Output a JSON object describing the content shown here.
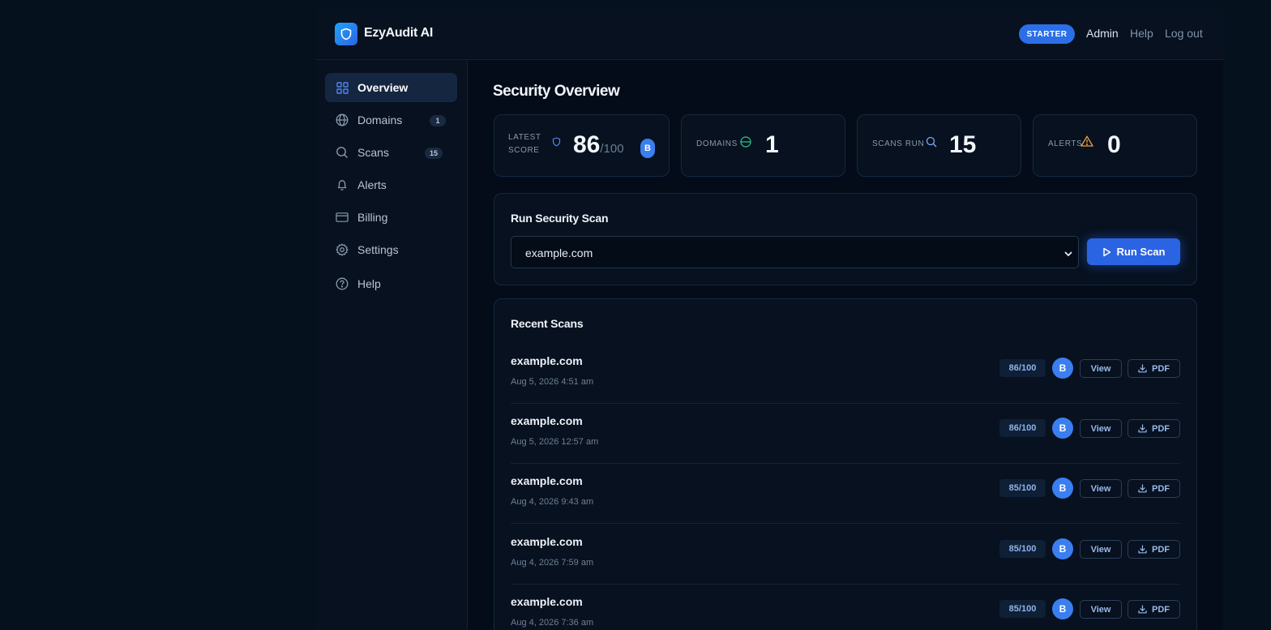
{
  "app": {
    "name": "EzyAudit AI",
    "brand_color": "#2b6fe8"
  },
  "header": {
    "plan": "STARTER",
    "admin": "Admin",
    "help": "Help",
    "logout": "Log out"
  },
  "sidebar": {
    "items": [
      {
        "label": "Overview",
        "icon": "grid-icon",
        "active": true
      },
      {
        "label": "Domains",
        "icon": "globe-icon",
        "count": "1"
      },
      {
        "label": "Scans",
        "icon": "search-icon",
        "count": "15"
      },
      {
        "label": "Alerts",
        "icon": "bell-icon"
      },
      {
        "label": "Billing",
        "icon": "credit-card-icon"
      },
      {
        "label": "Settings",
        "icon": "gear-icon"
      },
      {
        "label": "Help",
        "icon": "help-circle-icon"
      }
    ]
  },
  "main": {
    "title": "Security Overview",
    "stats": {
      "score": {
        "label_line1": "LATEST",
        "label_line2": "SCORE",
        "value": "86",
        "suffix": "/100",
        "grade": "B"
      },
      "domains": {
        "label": "DOMAINS",
        "value": "1"
      },
      "scans": {
        "label": "SCANS RUN",
        "value": "15"
      },
      "alerts": {
        "label": "ALERTS",
        "value": "0"
      }
    },
    "run_scan": {
      "title": "Run Security Scan",
      "selected_domain": "example.com",
      "button": "Run Scan"
    },
    "recent_scans": {
      "title": "Recent Scans",
      "view_label": "View",
      "pdf_label": "PDF",
      "rows": [
        {
          "domain": "example.com",
          "date": "Aug 5, 2026 4:51 am",
          "score": "86/100",
          "grade": "B"
        },
        {
          "domain": "example.com",
          "date": "Aug 5, 2026 12:57 am",
          "score": "86/100",
          "grade": "B"
        },
        {
          "domain": "example.com",
          "date": "Aug 4, 2026 9:43 am",
          "score": "85/100",
          "grade": "B"
        },
        {
          "domain": "example.com",
          "date": "Aug 4, 2026 7:59 am",
          "score": "85/100",
          "grade": "B"
        },
        {
          "domain": "example.com",
          "date": "Aug 4, 2026 7:36 am",
          "score": "85/100",
          "grade": "B"
        }
      ]
    }
  }
}
